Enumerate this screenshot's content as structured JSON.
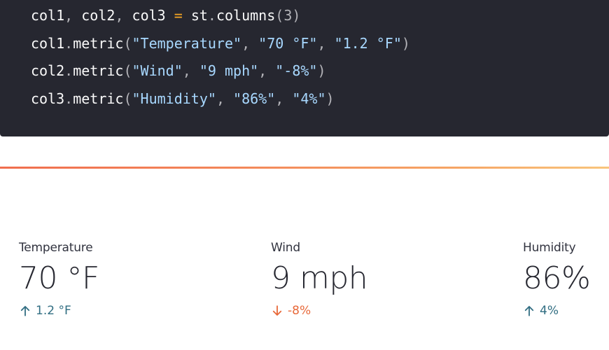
{
  "code": {
    "lines": [
      [
        {
          "t": "col1",
          "k": "name"
        },
        {
          "t": ", ",
          "k": "punct"
        },
        {
          "t": "col2",
          "k": "name"
        },
        {
          "t": ", ",
          "k": "punct"
        },
        {
          "t": "col3",
          "k": "name"
        },
        {
          "t": " = ",
          "k": "op"
        },
        {
          "t": "st",
          "k": "name"
        },
        {
          "t": ".",
          "k": "punct"
        },
        {
          "t": "columns",
          "k": "name"
        },
        {
          "t": "(",
          "k": "punct"
        },
        {
          "t": "3",
          "k": "num"
        },
        {
          "t": ")",
          "k": "punct"
        }
      ],
      [
        {
          "t": "col1",
          "k": "name"
        },
        {
          "t": ".",
          "k": "punct"
        },
        {
          "t": "metric",
          "k": "name"
        },
        {
          "t": "(",
          "k": "punct"
        },
        {
          "t": "\"Temperature\"",
          "k": "str"
        },
        {
          "t": ", ",
          "k": "punct"
        },
        {
          "t": "\"70 °F\"",
          "k": "str"
        },
        {
          "t": ", ",
          "k": "punct"
        },
        {
          "t": "\"1.2 °F\"",
          "k": "str"
        },
        {
          "t": ")",
          "k": "punct"
        }
      ],
      [
        {
          "t": "col2",
          "k": "name"
        },
        {
          "t": ".",
          "k": "punct"
        },
        {
          "t": "metric",
          "k": "name"
        },
        {
          "t": "(",
          "k": "punct"
        },
        {
          "t": "\"Wind\"",
          "k": "str"
        },
        {
          "t": ", ",
          "k": "punct"
        },
        {
          "t": "\"9 mph\"",
          "k": "str"
        },
        {
          "t": ", ",
          "k": "punct"
        },
        {
          "t": "\"-8%\"",
          "k": "str"
        },
        {
          "t": ")",
          "k": "punct"
        }
      ],
      [
        {
          "t": "col3",
          "k": "name"
        },
        {
          "t": ".",
          "k": "punct"
        },
        {
          "t": "metric",
          "k": "name"
        },
        {
          "t": "(",
          "k": "punct"
        },
        {
          "t": "\"Humidity\"",
          "k": "str"
        },
        {
          "t": ", ",
          "k": "punct"
        },
        {
          "t": "\"86%\"",
          "k": "str"
        },
        {
          "t": ", ",
          "k": "punct"
        },
        {
          "t": "\"4%\"",
          "k": "str"
        },
        {
          "t": ")",
          "k": "punct"
        }
      ]
    ]
  },
  "metrics": [
    {
      "label": "Temperature",
      "value": "70 °F",
      "delta": "1.2 °F",
      "direction": "up",
      "icon": "arrow-up-icon"
    },
    {
      "label": "Wind",
      "value": "9 mph",
      "delta": "-8%",
      "direction": "down",
      "icon": "arrow-down-icon"
    },
    {
      "label": "Humidity",
      "value": "86%",
      "delta": "4%",
      "direction": "up",
      "icon": "arrow-up-icon"
    }
  ],
  "colors": {
    "code_bg": "#262730",
    "delta_up": "#316e82",
    "delta_down": "#e8693a",
    "divider_start": "#f06e4e",
    "divider_end": "#f9c57c"
  }
}
